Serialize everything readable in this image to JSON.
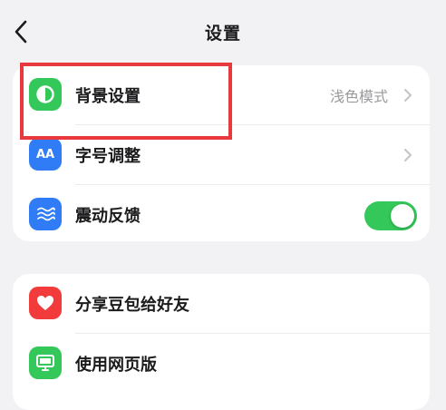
{
  "header": {
    "title": "设置"
  },
  "groups": [
    {
      "items": [
        {
          "icon": "contrast-icon",
          "icon_color": "#34c759",
          "label": "背景设置",
          "value": "浅色模式",
          "has_chevron": true
        },
        {
          "icon": "font-size-icon",
          "icon_color": "#2f7cf6",
          "label": "字号调整",
          "value": "",
          "has_chevron": true
        },
        {
          "icon": "vibration-icon",
          "icon_color": "#2f7cf6",
          "label": "震动反馈",
          "toggle_on": true
        }
      ]
    },
    {
      "items": [
        {
          "icon": "heart-icon",
          "icon_color": "#f23b3b",
          "label": "分享豆包给好友"
        },
        {
          "icon": "monitor-icon",
          "icon_color": "#34c759",
          "label": "使用网页版"
        }
      ]
    }
  ],
  "annotation": {
    "highlight_color": "#e8393f",
    "highlighted_item": "背景设置"
  },
  "icons": {
    "font_size_glyph": "AA"
  }
}
